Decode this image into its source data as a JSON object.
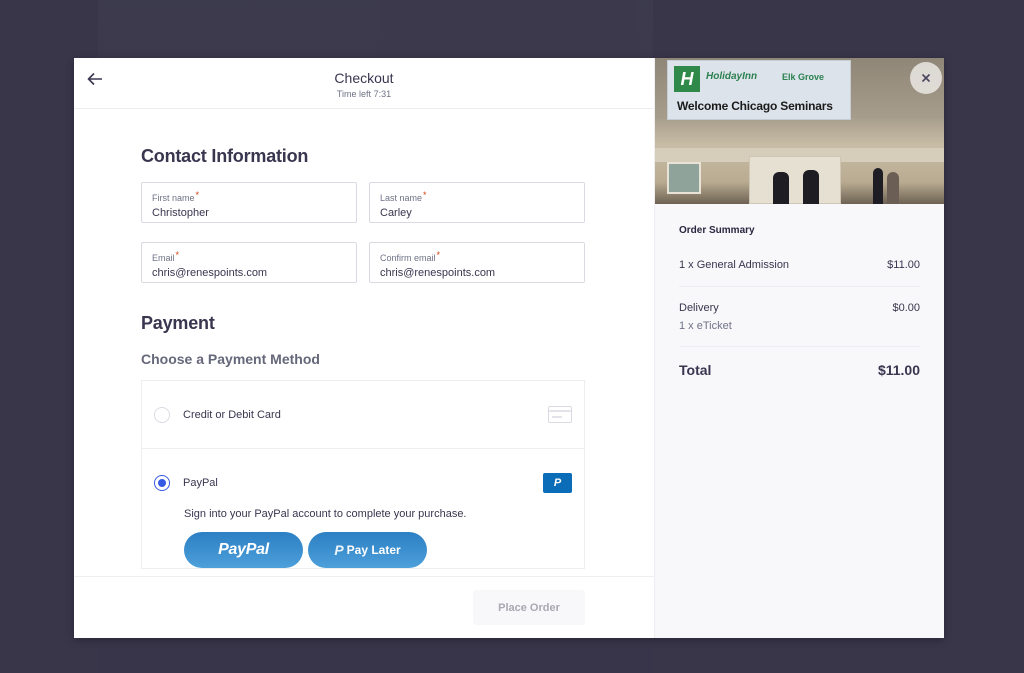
{
  "header": {
    "title": "Checkout",
    "timer": "Time left 7:31",
    "back_icon": "arrow-left-icon"
  },
  "contact": {
    "heading": "Contact Information",
    "fields": [
      {
        "label": "First name",
        "value": "Christopher",
        "required": true
      },
      {
        "label": "Last name",
        "value": "Carley",
        "required": true
      },
      {
        "label": "Email",
        "value": "chris@renespoints.com",
        "required": true
      },
      {
        "label": "Confirm email",
        "value": "chris@renespoints.com",
        "required": true
      }
    ],
    "required_mark": "*"
  },
  "payment": {
    "heading": "Payment",
    "subheading": "Choose a Payment Method",
    "methods": [
      {
        "label": "Credit or Debit Card",
        "selected": false,
        "icon": "credit-card-icon"
      },
      {
        "label": "PayPal",
        "selected": true,
        "icon": "paypal-icon",
        "badge": "P"
      }
    ],
    "paypal_description": "Sign into your PayPal account to complete your purchase.",
    "paypal_button": "PayPal",
    "pay_later_mark": "P",
    "pay_later_button": "Pay Later"
  },
  "footer": {
    "place_order": "Place Order"
  },
  "event_image": {
    "banner_logo": "H",
    "banner_brand": "HolidayInn",
    "banner_location": "Elk Grove",
    "banner_welcome": "Welcome Chicago Seminars"
  },
  "close_icon": "×",
  "order_summary": {
    "title": "Order Summary",
    "items": [
      {
        "label": "1 x General Admission",
        "price": "$11.00"
      }
    ],
    "delivery": {
      "label": "Delivery",
      "price": "$0.00",
      "note": "1 x eTicket"
    },
    "total": {
      "label": "Total",
      "price": "$11.00"
    }
  },
  "colors": {
    "accent": "#3659e3",
    "paypal_blue": "#0b6cb8",
    "text": "#39364f",
    "backdrop": "#39364a"
  }
}
